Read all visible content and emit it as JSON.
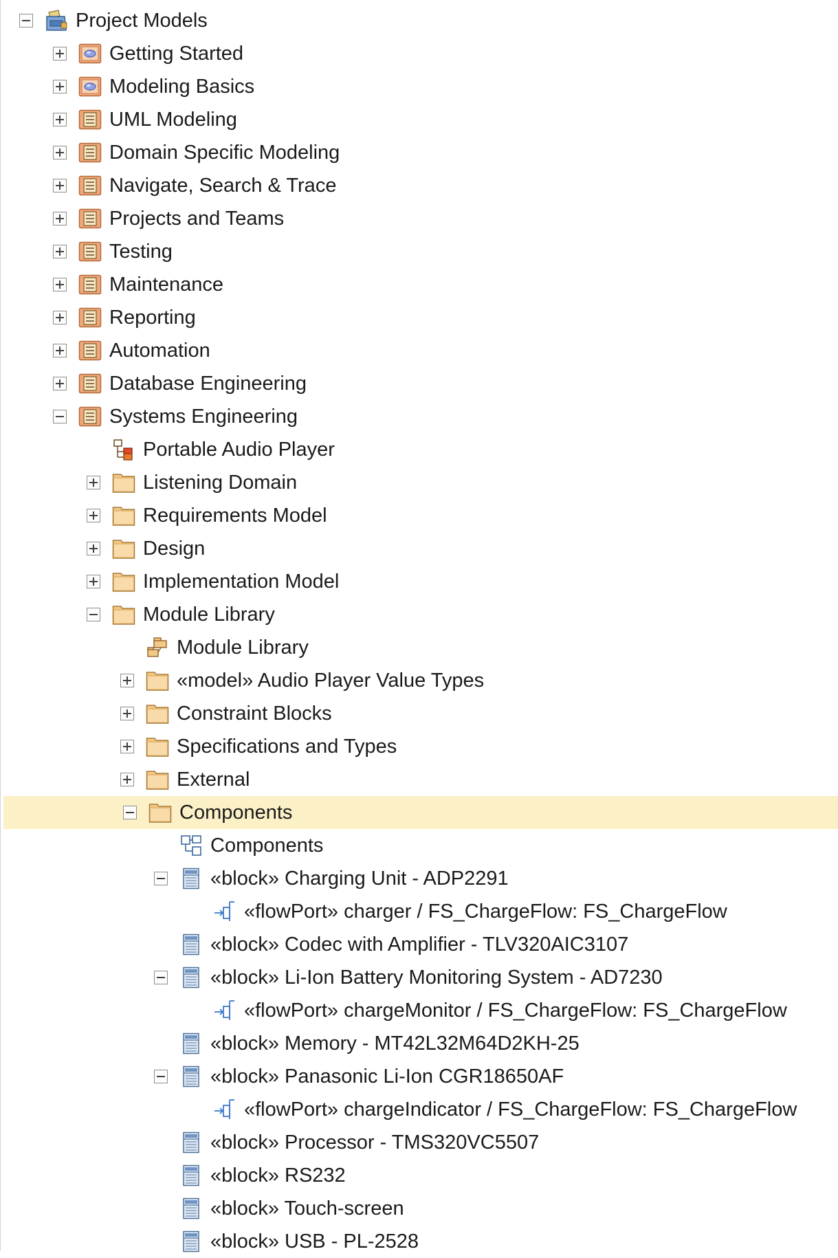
{
  "tree": {
    "nodes": [
      {
        "label": "Project Models",
        "icon": "project-models-icon",
        "expander": "minus",
        "level": 0
      },
      {
        "label": "Getting Started",
        "icon": "model-package-icon",
        "expander": "plus",
        "level": 1
      },
      {
        "label": "Modeling Basics",
        "icon": "model-package-icon",
        "expander": "plus",
        "level": 1
      },
      {
        "label": "UML Modeling",
        "icon": "view-package-icon",
        "expander": "plus",
        "level": 1
      },
      {
        "label": "Domain Specific Modeling",
        "icon": "view-package-icon",
        "expander": "plus",
        "level": 1
      },
      {
        "label": "Navigate, Search & Trace",
        "icon": "view-package-icon",
        "expander": "plus",
        "level": 1
      },
      {
        "label": "Projects and Teams",
        "icon": "view-package-icon",
        "expander": "plus",
        "level": 1
      },
      {
        "label": "Testing",
        "icon": "view-package-icon",
        "expander": "plus",
        "level": 1
      },
      {
        "label": "Maintenance",
        "icon": "view-package-icon",
        "expander": "plus",
        "level": 1
      },
      {
        "label": "Reporting",
        "icon": "view-package-icon",
        "expander": "plus",
        "level": 1
      },
      {
        "label": "Automation",
        "icon": "view-package-icon",
        "expander": "plus",
        "level": 1
      },
      {
        "label": "Database Engineering",
        "icon": "view-package-icon",
        "expander": "plus",
        "level": 1
      },
      {
        "label": "Systems Engineering",
        "icon": "view-package-icon",
        "expander": "minus",
        "level": 1
      },
      {
        "label": "Portable Audio Player",
        "icon": "diagram-icon",
        "expander": "none",
        "level": 2
      },
      {
        "label": "Listening Domain",
        "icon": "folder-icon",
        "expander": "plus",
        "level": 2
      },
      {
        "label": "Requirements Model",
        "icon": "folder-icon",
        "expander": "plus",
        "level": 2
      },
      {
        "label": "Design",
        "icon": "folder-icon",
        "expander": "plus",
        "level": 2
      },
      {
        "label": "Implementation Model",
        "icon": "folder-icon",
        "expander": "plus",
        "level": 2
      },
      {
        "label": "Module Library",
        "icon": "folder-icon",
        "expander": "minus",
        "level": 2
      },
      {
        "label": "Module Library",
        "icon": "package-diagram-icon",
        "expander": "none",
        "level": 3
      },
      {
        "label": "«model» Audio Player Value Types",
        "icon": "folder-icon",
        "expander": "plus",
        "level": 3
      },
      {
        "label": "Constraint Blocks",
        "icon": "folder-icon",
        "expander": "plus",
        "level": 3
      },
      {
        "label": "Specifications and Types",
        "icon": "folder-icon",
        "expander": "plus",
        "level": 3
      },
      {
        "label": "External",
        "icon": "folder-icon",
        "expander": "plus",
        "level": 3
      },
      {
        "label": "Components",
        "icon": "folder-icon",
        "expander": "minus",
        "level": 3,
        "selected": true
      },
      {
        "label": "Components",
        "icon": "block-diagram-icon",
        "expander": "none",
        "level": 4
      },
      {
        "label": "«block» Charging Unit - ADP2291",
        "icon": "block-icon",
        "expander": "minus",
        "level": 4
      },
      {
        "label": "«flowPort» charger / FS_ChargeFlow: FS_ChargeFlow",
        "icon": "flow-port-icon",
        "expander": "none",
        "level": 5
      },
      {
        "label": "«block» Codec with Amplifier - TLV320AIC3107",
        "icon": "block-icon",
        "expander": "none",
        "level": 4
      },
      {
        "label": "«block» Li-Ion Battery Monitoring System - AD7230",
        "icon": "block-icon",
        "expander": "minus",
        "level": 4
      },
      {
        "label": "«flowPort» chargeMonitor / FS_ChargeFlow: FS_ChargeFlow",
        "icon": "flow-port-icon",
        "expander": "none",
        "level": 5
      },
      {
        "label": "«block» Memory - MT42L32M64D2KH-25",
        "icon": "block-icon",
        "expander": "none",
        "level": 4
      },
      {
        "label": "«block» Panasonic Li-Ion CGR18650AF",
        "icon": "block-icon",
        "expander": "minus",
        "level": 4
      },
      {
        "label": "«flowPort» chargeIndicator / FS_ChargeFlow: FS_ChargeFlow",
        "icon": "flow-port-icon",
        "expander": "none",
        "level": 5
      },
      {
        "label": "«block» Processor - TMS320VC5507",
        "icon": "block-icon",
        "expander": "none",
        "level": 4
      },
      {
        "label": "«block» RS232",
        "icon": "block-icon",
        "expander": "none",
        "level": 4
      },
      {
        "label": "«block» Touch-screen",
        "icon": "block-icon",
        "expander": "none",
        "level": 4
      },
      {
        "label": "«block» USB - PL-2528",
        "icon": "block-icon",
        "expander": "none",
        "level": 4
      }
    ]
  },
  "colors": {
    "selection": "#fcf1c6",
    "folder": "#f2c987",
    "block": "#c9d9ec",
    "flow_port": "#3c78c8"
  }
}
